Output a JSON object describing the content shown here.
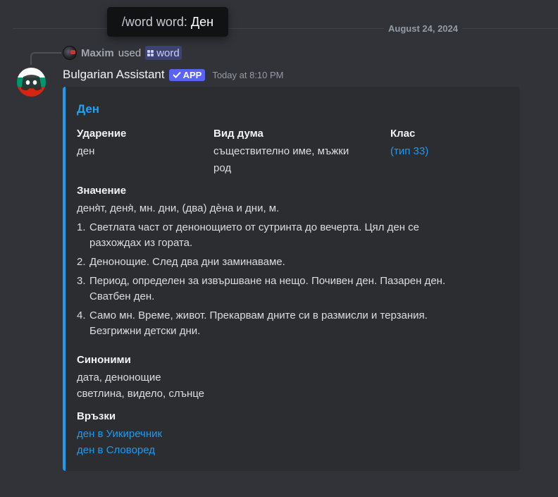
{
  "tooltip": {
    "command": "/word word:",
    "value": "Ден"
  },
  "date_divider": "August 24, 2024",
  "reply": {
    "username": "Maxim",
    "used_text": "used",
    "command": "word"
  },
  "message": {
    "author": "Bulgarian Assistant",
    "badge": "APP",
    "timestamp": "Today at 8:10 PM"
  },
  "embed": {
    "title": "Ден",
    "accent_color": "#1e9bf0",
    "stress": {
      "label": "Ударение",
      "value": "ден"
    },
    "word_type": {
      "label": "Вид дума",
      "value_line1": "съществително име, мъжки",
      "value_line2": "род"
    },
    "class": {
      "label": "Клас",
      "value": "(тип 33)"
    },
    "meaning": {
      "label": "Значение",
      "forms": "деня̀т, деня̀, мн. дни, (два) дѐна и дни, м.",
      "items": [
        {
          "num": "1.",
          "line1": "Светлата част от денонощието от сутринта до вечерта. Цял ден се",
          "line2": "разхождах из гората."
        },
        {
          "num": "2.",
          "line1": "Денонощие. След два дни заминаваме.",
          "line2": ""
        },
        {
          "num": "3.",
          "line1": "Период, определен за извършване на нещо. Почивен ден. Пазарен ден.",
          "line2": "Сватбен ден."
        },
        {
          "num": "4.",
          "line1": "Само мн. Време, живот. Прекарвам дните си в размисли и терзания.",
          "line2": "Безгрижни детски дни."
        }
      ]
    },
    "synonyms": {
      "label": "Синоними",
      "line1": "дата, денонощие",
      "line2": "светлина, видело, слънце"
    },
    "links": {
      "label": "Връзки",
      "link1": "ден в Уикиречник",
      "link2": "ден в Словоред"
    }
  },
  "colors": {
    "background": "#323339",
    "embed_bg": "#2b2d31",
    "link": "#1e9bf0",
    "app_badge": "#5865f2"
  },
  "icons": {
    "avatar": "discord-bot-icon",
    "badge_check": "checkmark-icon",
    "command": "command-grid-icon"
  }
}
